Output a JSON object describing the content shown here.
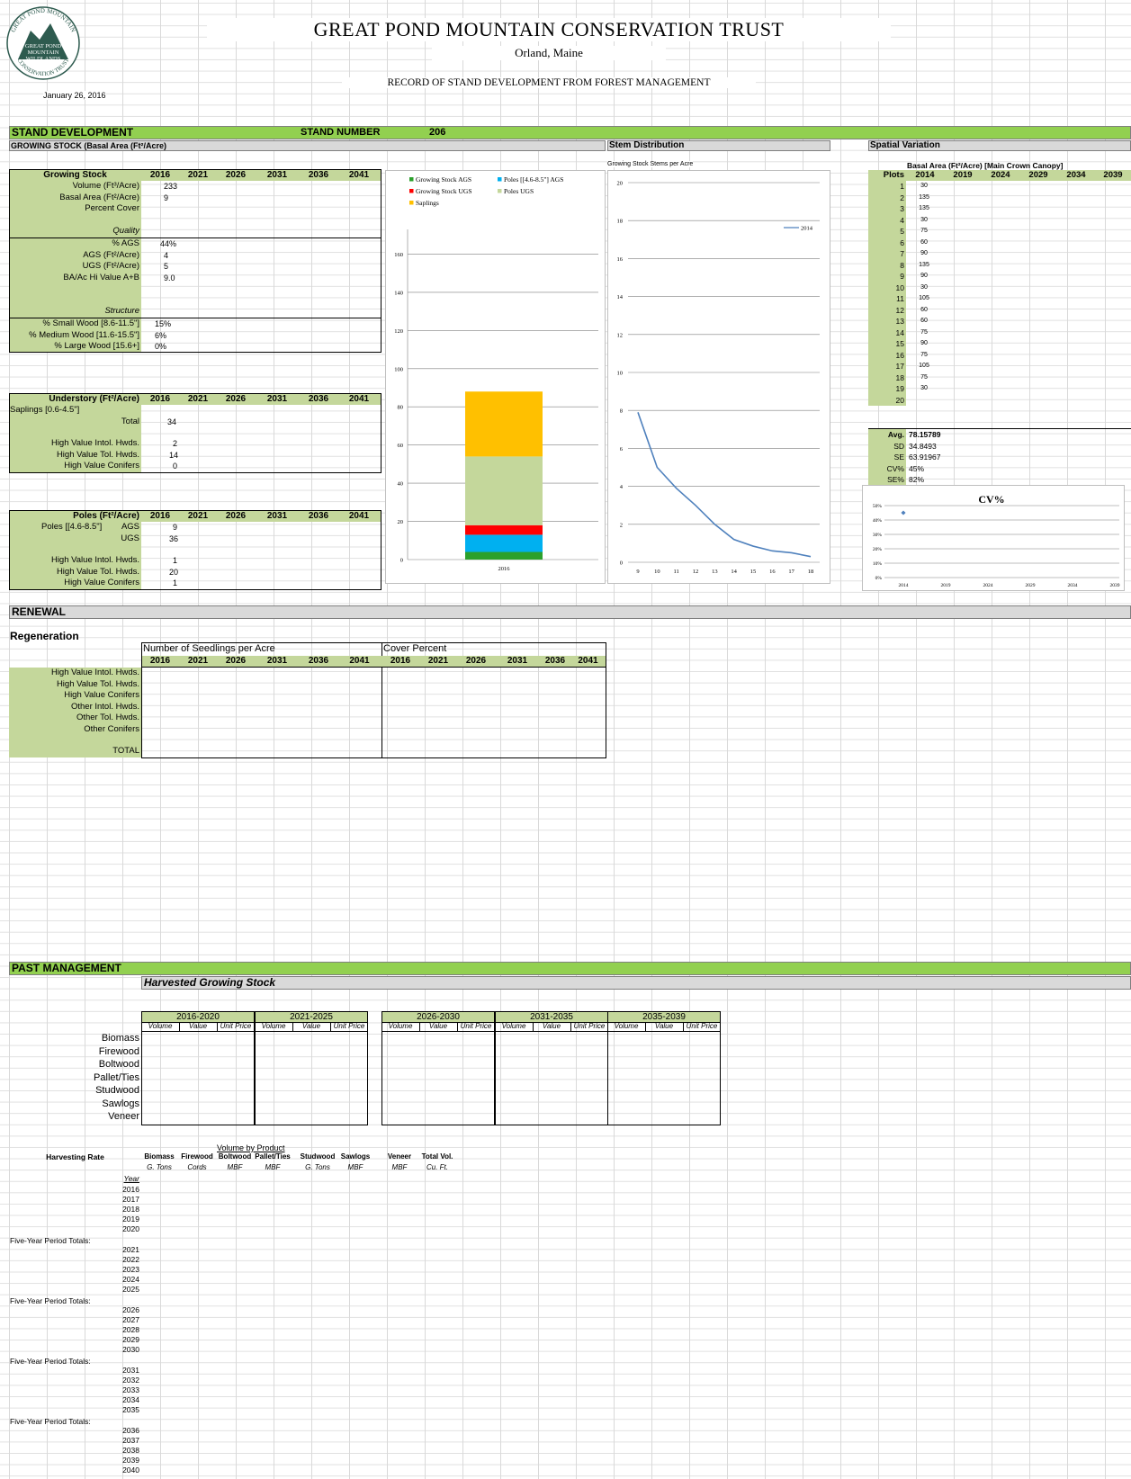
{
  "header": {
    "title": "GREAT POND MOUNTAIN CONSERVATION TRUST",
    "location": "Orland, Maine",
    "record_title": "RECORD OF STAND DEVELOPMENT FROM FOREST MANAGEMENT",
    "date": "January 26, 2016",
    "logo": {
      "top": "GREAT POND MOUNTAIN",
      "line1": "GREAT POND",
      "line2": "MOUNTAIN",
      "line3": "WILDLANDS",
      "bottom": "CONSERVATION TRUST"
    }
  },
  "stand": {
    "section": "STAND DEVELOPMENT",
    "number_label": "STAND NUMBER",
    "number": "206",
    "growing_stock_sub": "GROWING STOCK (Basal Area (Ft²/Acre)",
    "stem_dist": "Stem Distribution",
    "spatial": "Spatial Variation"
  },
  "years": [
    "2016",
    "2021",
    "2026",
    "2031",
    "2036",
    "2041"
  ],
  "growing": {
    "header": "Growing Stock",
    "rows": [
      {
        "label": "Volume (Ft³/Acre)",
        "v": "233"
      },
      {
        "label": "Basal Area (Ft²/Acre)",
        "v": "9"
      },
      {
        "label": "Percent Cover",
        "v": ""
      }
    ],
    "quality_label": "Quality",
    "quality": [
      {
        "label": "% AGS",
        "v": "44%"
      },
      {
        "label": "AGS (Ft²/Acre)",
        "v": "4"
      },
      {
        "label": "UGS (Ft²/Acre)",
        "v": "5"
      },
      {
        "label": "BA/Ac Hi Value A+B",
        "v": "9.0"
      }
    ],
    "structure_label": "Structure",
    "structure": [
      {
        "label": "% Small Wood [8.6-11.5\"]",
        "v": "15%"
      },
      {
        "label": "% Medium Wood [11.6-15.5\"]",
        "v": "6%"
      },
      {
        "label": "% Large Wood [15.6+]",
        "v": "0%"
      }
    ]
  },
  "understory": {
    "header": "Understory (Ft²/Acre)",
    "saplings": "Saplings [0.6-4.5\"]",
    "total_label": "Total",
    "total": "34",
    "rows": [
      {
        "label": "High Value Intol. Hwds.",
        "v": "2"
      },
      {
        "label": "High Value Tol. Hwds.",
        "v": "14"
      },
      {
        "label": "High Value Conifers",
        "v": "0"
      }
    ]
  },
  "poles": {
    "header": "Poles (Ft²/Acre)",
    "label": "Poles [[4.6-8.5\"]",
    "ags_label": "AGS",
    "ags": "9",
    "ugs_label": "UGS",
    "ugs": "36",
    "rows": [
      {
        "label": "High Value Intol. Hwds.",
        "v": "1"
      },
      {
        "label": "High Value Tol. Hwds.",
        "v": "20"
      },
      {
        "label": "High Value Conifers",
        "v": "1"
      }
    ]
  },
  "chart_data": [
    {
      "type": "bar",
      "stacked": true,
      "categories": [
        "2016"
      ],
      "ylim": [
        0,
        180
      ],
      "yticks": [
        0,
        20,
        40,
        60,
        80,
        100,
        120,
        140,
        160
      ],
      "series": [
        {
          "name": "Growing Stock AGS",
          "color": "#2ca02c",
          "values": [
            4
          ]
        },
        {
          "name": "Poles [[4.6-8.5\"]   AGS",
          "color": "#00b0f0",
          "values": [
            9
          ]
        },
        {
          "name": "Growing Stock UGS",
          "color": "#ff0000",
          "values": [
            5
          ]
        },
        {
          "name": "Poles UGS",
          "color": "#c4d79b",
          "values": [
            36
          ]
        },
        {
          "name": "Saplings",
          "color": "#ffc000",
          "values": [
            34
          ]
        }
      ],
      "legend": "top"
    },
    {
      "type": "line",
      "title": "Growing Stock Stems per Acre",
      "x": [
        9,
        10,
        11,
        12,
        13,
        14,
        15,
        16,
        17,
        18
      ],
      "ylim": [
        0,
        20
      ],
      "yticks": [
        0,
        2,
        4,
        6,
        8,
        10,
        12,
        14,
        16,
        18,
        20
      ],
      "series": [
        {
          "name": "2014",
          "color": "#4f81bd",
          "values": [
            7.9,
            5.0,
            3.9,
            3.0,
            2.0,
            1.2,
            0.85,
            0.6,
            0.5,
            0.3
          ]
        }
      ],
      "legend": "top-right"
    },
    {
      "type": "scatter",
      "title": "CV%",
      "x": [
        "2014",
        "2019",
        "2024",
        "2029",
        "2034",
        "2039"
      ],
      "ylim": [
        0,
        50
      ],
      "yticks": [
        "0%",
        "10%",
        "20%",
        "30%",
        "40%",
        "50%"
      ],
      "series": [
        {
          "values": [
            45,
            null,
            null,
            null,
            null,
            null
          ]
        }
      ]
    }
  ],
  "spatial": {
    "title": "Basal Area (Ft²/Acre) [Main Crown Canopy]",
    "plots_label": "Plots",
    "years": [
      "2014",
      "2019",
      "2024",
      "2029",
      "2034",
      "2039"
    ],
    "plots": [
      "1",
      "2",
      "3",
      "4",
      "5",
      "6",
      "7",
      "8",
      "9",
      "10",
      "11",
      "12",
      "13",
      "14",
      "15",
      "16",
      "17",
      "18",
      "19",
      "20"
    ],
    "values": [
      "30",
      "135",
      "135",
      "30",
      "75",
      "60",
      "90",
      "135",
      "90",
      "30",
      "105",
      "60",
      "60",
      "75",
      "90",
      "75",
      "105",
      "75",
      "30",
      ""
    ],
    "stats": [
      {
        "label": "Avg.",
        "v": "78.15789"
      },
      {
        "label": "SD",
        "v": "34.8493"
      },
      {
        "label": "SE",
        "v": "63.91967"
      },
      {
        "label": "CV%",
        "v": "45%"
      },
      {
        "label": "SE%",
        "v": "82%"
      }
    ]
  },
  "renewal": {
    "section": "RENEWAL",
    "regen": "Regeneration",
    "seedlings": "Number of Seedlings per Acre",
    "cover": "Cover Percent",
    "rows": [
      "High Value Intol. Hwds.",
      "High Value Tol. Hwds.",
      "High Value Conifers",
      "Other Intol. Hwds.",
      "Other Tol. Hwds.",
      "Other Conifers"
    ],
    "total": "TOTAL"
  },
  "past": {
    "section": "PAST MANAGEMENT",
    "harvested": "Harvested Growing Stock",
    "periods": [
      "2016-2020",
      "2021-2025",
      "2026-2030",
      "2031-2035",
      "2035-2039"
    ],
    "sub": [
      "Volume",
      "Value",
      "Unit Price"
    ],
    "products": [
      "Biomass",
      "Firewood",
      "Boltwood",
      "Pallet/Ties",
      "Studwood",
      "Sawlogs",
      "Veneer"
    ],
    "rate_label": "Harvesting Rate",
    "vol_by_product": "Volume by Product",
    "rate_cols": [
      "Biomass",
      "Firewood",
      "Boltwood",
      "Pallet/Ties",
      "Studwood",
      "Sawlogs",
      "Veneer",
      "Total Vol."
    ],
    "rate_units": [
      "G. Tons",
      "Cords",
      "MBF",
      "MBF",
      "G. Tons",
      "MBF",
      "MBF",
      "Cu. Ft."
    ],
    "year_label": "Year",
    "period_total": "Five-Year Period Totals:",
    "groups": [
      [
        "2016",
        "2017",
        "2018",
        "2019",
        "2020"
      ],
      [
        "2021",
        "2022",
        "2023",
        "2024",
        "2025"
      ],
      [
        "2026",
        "2027",
        "2028",
        "2029",
        "2030"
      ],
      [
        "2031",
        "2032",
        "2033",
        "2034",
        "2035"
      ],
      [
        "2036",
        "2037",
        "2038",
        "2039",
        "2040"
      ]
    ]
  }
}
